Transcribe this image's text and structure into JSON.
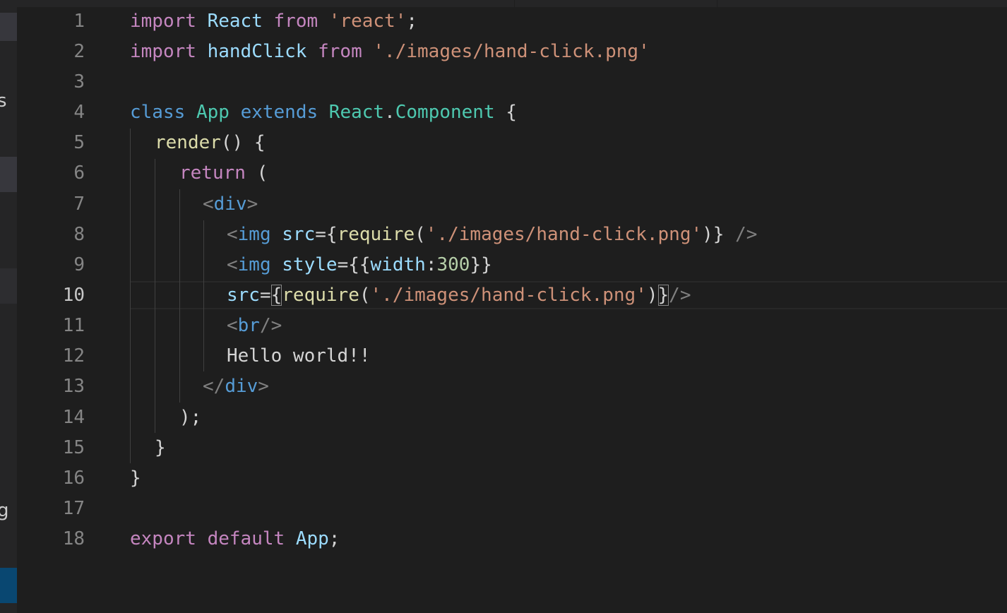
{
  "sidebar": {
    "letter_top": "s",
    "letter_bottom": "g"
  },
  "gutter": {
    "line_numbers": [
      "1",
      "2",
      "3",
      "4",
      "5",
      "6",
      "7",
      "8",
      "9",
      "10",
      "11",
      "12",
      "13",
      "14",
      "15",
      "16",
      "17",
      "18"
    ],
    "active_line": "10"
  },
  "code": {
    "l1": {
      "t0": "import",
      "t1": " ",
      "t2": "React",
      "t3": " ",
      "t4": "from",
      "t5": " ",
      "t6": "'react'",
      "t7": ";"
    },
    "l2": {
      "t0": "import",
      "t1": " ",
      "t2": "handClick",
      "t3": " ",
      "t4": "from",
      "t5": " ",
      "t6": "'./images/hand-click.png'"
    },
    "l4": {
      "t0": "class",
      "t1": " ",
      "t2": "App",
      "t3": " ",
      "t4": "extends",
      "t5": " ",
      "t6": "React",
      "t7": ".",
      "t8": "Component",
      "t9": " {"
    },
    "l5": {
      "t0": "render",
      "t1": "() {"
    },
    "l6": {
      "t0": "return",
      "t1": " ("
    },
    "l7": {
      "t0": "<",
      "t1": "div",
      "t2": ">"
    },
    "l8": {
      "t0": "<",
      "t1": "img",
      "t2": " ",
      "t3": "src",
      "t4": "={",
      "t5": "require",
      "t6": "(",
      "t7": "'./images/hand-click.png'",
      "t8": ")}",
      "t9": " ",
      "t10": "/>"
    },
    "l9": {
      "t0": "<",
      "t1": "img",
      "t2": " ",
      "t3": "style",
      "t4": "={{",
      "t5": "width",
      "t6": ":",
      "t7": "300",
      "t8": "}}"
    },
    "l10": {
      "t0": "src",
      "t1": "=",
      "t2": "{",
      "t3": "require",
      "t4": "(",
      "t5": "'./images/hand-click.png'",
      "t6": ")",
      "t7": "}",
      "t8": "/>"
    },
    "l11": {
      "t0": "<",
      "t1": "br",
      "t2": "/>"
    },
    "l12": {
      "t0": "Hello world!!"
    },
    "l13": {
      "t0": "</",
      "t1": "div",
      "t2": ">"
    },
    "l14": {
      "t0": ");"
    },
    "l15": {
      "t0": "}"
    },
    "l16": {
      "t0": "}"
    },
    "l18": {
      "t0": "export",
      "t1": " ",
      "t2": "default",
      "t3": " ",
      "t4": "App",
      "t5": ";"
    }
  }
}
